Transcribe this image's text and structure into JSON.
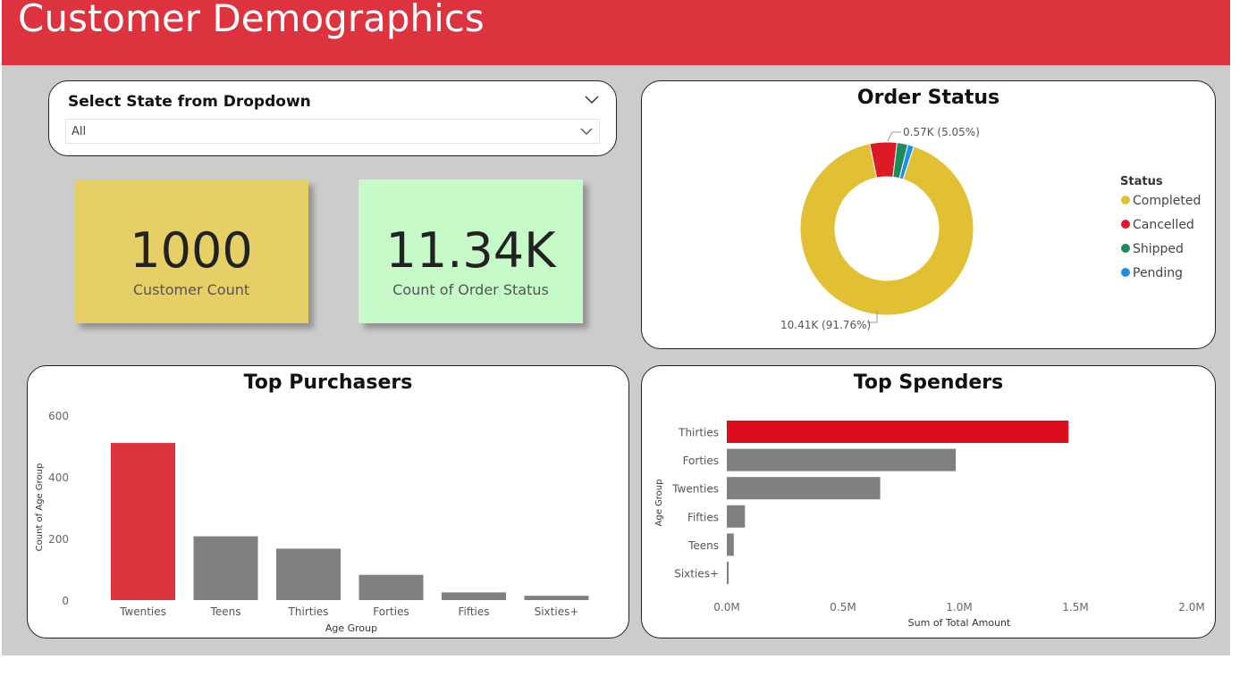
{
  "header": {
    "title": "Customer Demographics"
  },
  "slicer": {
    "title": "Select State from Dropdown",
    "selected": "All"
  },
  "kpis": [
    {
      "value": "1000",
      "label": "Customer Count"
    },
    {
      "value": "11.34K",
      "label": "Count of Order Status"
    }
  ],
  "colors": {
    "header": "#dc333f",
    "canvas": "#cccccc",
    "highlight": "#dc333f",
    "bar_gray": "#808080",
    "kpi1": "#e6cf66",
    "kpi2": "#c7fac9"
  },
  "order_status": {
    "title": "Order Status",
    "legend_title": "Status",
    "callouts": {
      "cancelled": "0.57K (5.05%)",
      "completed": "10.41K (91.76%)"
    }
  },
  "top_purchasers": {
    "title": "Top Purchasers"
  },
  "top_spenders": {
    "title": "Top Spenders"
  },
  "chart_data": [
    {
      "type": "pie",
      "title": "Order Status",
      "legend_title": "Status",
      "categories": [
        "Completed",
        "Cancelled",
        "Shipped",
        "Pending"
      ],
      "values": [
        10410,
        573,
        230,
        130
      ],
      "colors": [
        "#e2c033",
        "#dc1a26",
        "#1c8a5a",
        "#1f8fe6"
      ],
      "data_labels": [
        "10.41K (91.76%)",
        "0.57K (5.05%)"
      ],
      "donut": true,
      "legend": "right"
    },
    {
      "type": "bar",
      "title": "Top Purchasers",
      "categories": [
        "Twenties",
        "Teens",
        "Thirties",
        "Forties",
        "Fifties",
        "Sixties+"
      ],
      "values": [
        510,
        207,
        167,
        82,
        25,
        14
      ],
      "xlabel": "Age Group",
      "ylabel": "Count of Age Group",
      "ylim": [
        0,
        600
      ],
      "yticks": [
        "0",
        "200",
        "400",
        "600"
      ],
      "highlight": "Twenties",
      "grid": false
    },
    {
      "type": "bar",
      "orientation": "horizontal",
      "title": "Top Spenders",
      "categories": [
        "Thirties",
        "Forties",
        "Twenties",
        "Fifties",
        "Teens",
        "Sixties+"
      ],
      "values": [
        1470000,
        985000,
        660000,
        78000,
        30000,
        8000
      ],
      "xlabel": "Sum of Total Amount",
      "ylabel": "Age Group",
      "xlim": [
        0,
        2000000
      ],
      "xticks": [
        "0.0M",
        "0.5M",
        "1.0M",
        "1.5M",
        "2.0M"
      ],
      "highlight": "Thirties",
      "grid": false
    }
  ]
}
